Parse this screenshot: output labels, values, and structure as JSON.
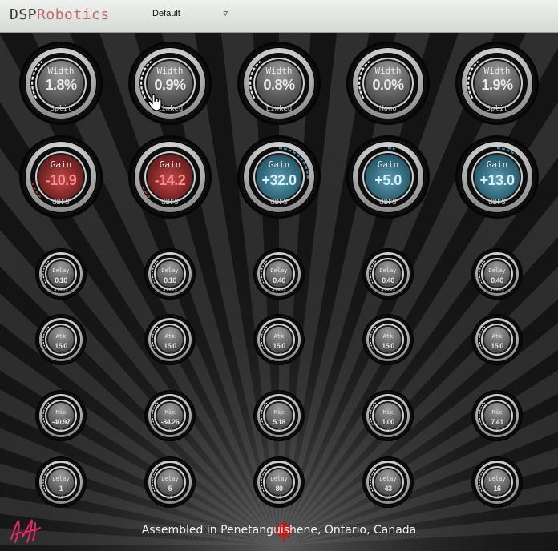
{
  "header": {
    "brand_a": "DSP",
    "brand_b": "Robotics",
    "preset": "Default"
  },
  "rows": [
    {
      "kind": "width",
      "knobs": [
        {
          "label": "Width",
          "value": "1.8%",
          "unit": "Split"
        },
        {
          "label": "Width",
          "value": "0.9%",
          "unit": "Linked"
        },
        {
          "label": "Width",
          "value": "0.8%",
          "unit": "Linked"
        },
        {
          "label": "Width",
          "value": "0.0%",
          "unit": "Mono"
        },
        {
          "label": "Width",
          "value": "1.9%",
          "unit": "Split"
        }
      ]
    },
    {
      "kind": "gain",
      "knobs": [
        {
          "label": "Gain",
          "value": "-10.9",
          "unit": "dBFS",
          "tone": "red",
          "level": 0.12
        },
        {
          "label": "Gain",
          "value": "-14.2",
          "unit": "dBFS",
          "tone": "red",
          "level": 0.1
        },
        {
          "label": "Gain",
          "value": "+32.0",
          "unit": "dBFS",
          "tone": "blue",
          "level": 0.85
        },
        {
          "label": "Gain",
          "value": "+5.0",
          "unit": "dBFS",
          "tone": "blue",
          "level": 0.55
        },
        {
          "label": "Gain",
          "value": "+13.0",
          "unit": "dBFS",
          "tone": "blue",
          "level": 0.65
        }
      ]
    },
    {
      "kind": "small",
      "knobs": [
        {
          "label": "Delay",
          "value": "0.10",
          "unit": "Steps"
        },
        {
          "label": "Delay",
          "value": "0.10",
          "unit": "Steps"
        },
        {
          "label": "Delay",
          "value": "0.40",
          "unit": "Steps"
        },
        {
          "label": "Delay",
          "value": "0.40",
          "unit": "Steps"
        },
        {
          "label": "Delay",
          "value": "0.40",
          "unit": "Steps"
        }
      ]
    },
    {
      "kind": "small",
      "knobs": [
        {
          "label": "Atk",
          "value": "15.0",
          "unit": "mS"
        },
        {
          "label": "Atk",
          "value": "15.0",
          "unit": "mS"
        },
        {
          "label": "Atk",
          "value": "15.0",
          "unit": "mS"
        },
        {
          "label": "Atk",
          "value": "15.0",
          "unit": "mS"
        },
        {
          "label": "Atk",
          "value": "15.0",
          "unit": "mS"
        }
      ]
    },
    {
      "kind": "small",
      "knobs": [
        {
          "label": "Mix",
          "value": "-40.97",
          "unit": "dB"
        },
        {
          "label": "Mix",
          "value": "-34.26",
          "unit": "dB"
        },
        {
          "label": "Mix",
          "value": "5.18",
          "unit": "dB"
        },
        {
          "label": "Mix",
          "value": "1.00",
          "unit": "dB"
        },
        {
          "label": "Mix",
          "value": "7.41",
          "unit": "dB"
        }
      ]
    },
    {
      "kind": "small",
      "knobs": [
        {
          "label": "Delay",
          "value": "1",
          "unit": "mS"
        },
        {
          "label": "Delay",
          "value": "5",
          "unit": "mS"
        },
        {
          "label": "Delay",
          "value": "80",
          "unit": "mS"
        },
        {
          "label": "Delay",
          "value": "43",
          "unit": "mS"
        },
        {
          "label": "Delay",
          "value": "16",
          "unit": "mS"
        }
      ]
    }
  ],
  "footer": {
    "text": "Assembled in Penetanguishene, Ontario, Canada"
  },
  "icons": {
    "signature": "signature-icon",
    "leaf": "maple-leaf-icon",
    "cursor": "hand-cursor-icon"
  },
  "colors": {
    "brand_accent": "#c06a6a",
    "gain_negative": "#a83a3a",
    "gain_positive": "#3f8aa3"
  }
}
